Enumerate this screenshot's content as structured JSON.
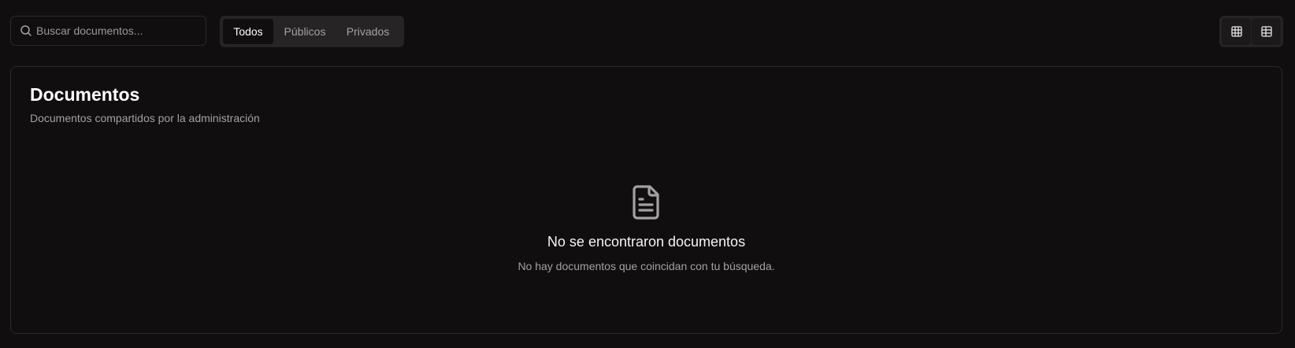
{
  "search": {
    "placeholder": "Buscar documentos...",
    "icon": "search-icon"
  },
  "filter_tabs": [
    {
      "label": "Todos",
      "active": true
    },
    {
      "label": "Públicos",
      "active": false
    },
    {
      "label": "Privados",
      "active": false
    }
  ],
  "view_toggle": {
    "buttons": [
      {
        "icon": "grid-icon",
        "active": false
      },
      {
        "icon": "table-icon",
        "active": false
      }
    ]
  },
  "card": {
    "title": "Documentos",
    "subtitle": "Documentos compartidos por la administración"
  },
  "empty_state": {
    "icon": "document-icon",
    "title": "No se encontraron documentos",
    "message": "No hay documentos que coincidan con tu búsqueda."
  },
  "colors": {
    "background": "#100e0f",
    "border": "#2b292a",
    "segment_bg": "#262425",
    "text_primary": "#ffffff",
    "text_muted": "#a3a1a2"
  }
}
